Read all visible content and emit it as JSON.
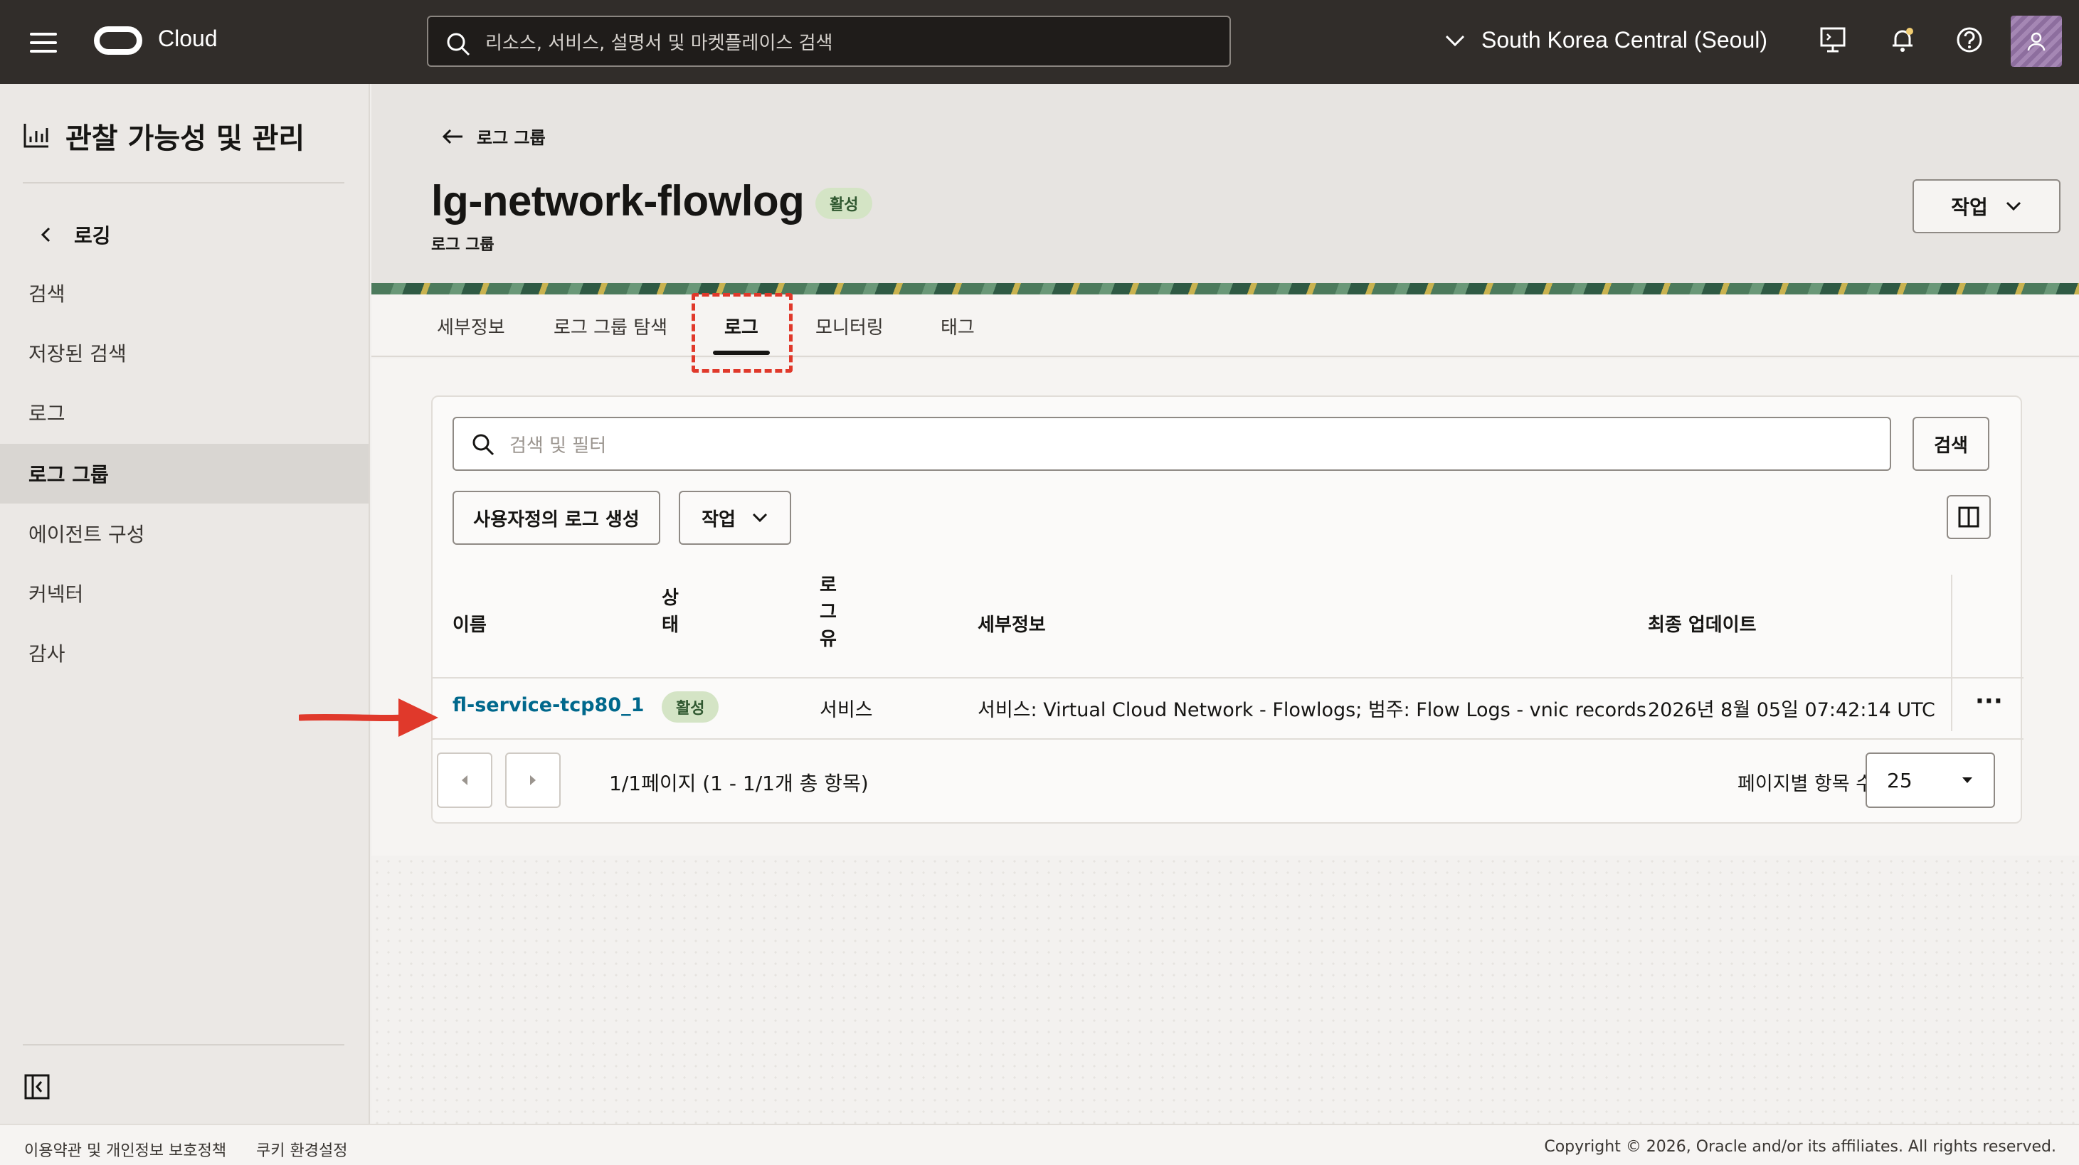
{
  "header": {
    "app_name": "Cloud",
    "search_placeholder": "리소스, 서비스, 설명서 및 마켓플레이스 검색",
    "region": "South Korea Central (Seoul)"
  },
  "sidebar": {
    "title": "관찰 가능성 및 관리",
    "back_label": "로깅",
    "items": [
      {
        "label": "검색"
      },
      {
        "label": "저장된 검색"
      },
      {
        "label": "로그"
      },
      {
        "label": "로그 그룹"
      },
      {
        "label": "에이전트 구성"
      },
      {
        "label": "커넥터"
      },
      {
        "label": "감사"
      }
    ]
  },
  "page": {
    "back_label": "로그 그룹",
    "title": "lg-network-flowlog",
    "status_badge": "활성",
    "subtitle": "로그 그룹",
    "actions_label": "작업"
  },
  "tabs": [
    {
      "label": "세부정보"
    },
    {
      "label": "로그 그룹 탐색"
    },
    {
      "label": "로그"
    },
    {
      "label": "모니터링"
    },
    {
      "label": "태그"
    }
  ],
  "toolbar": {
    "search_placeholder": "검색 및 필터",
    "search_button": "검색",
    "create_button": "사용자정의 로그 생성",
    "actions_button": "작업"
  },
  "table": {
    "columns": {
      "name": "이름",
      "status_1": "상",
      "status_2": "태",
      "type_1": "로",
      "type_2": "그",
      "type_3": "유",
      "details": "세부정보",
      "updated": "최종 업데이트"
    },
    "rows": [
      {
        "name": "fl-service-tcp80_1",
        "status": "활성",
        "type": "서비스",
        "details": "서비스: Virtual Cloud Network - Flowlogs; 범주: Flow Logs - vnic records",
        "updated": "2026년 8월 05일 07:42:14 UTC",
        "more": "···"
      }
    ]
  },
  "pagination": {
    "text": "1/1페이지 (1 - 1/1개 총 항목)",
    "per_page_label": "페이지별 항목 수",
    "per_page_value": "25"
  },
  "footer": {
    "terms": "이용약관 및 개인정보 보호정책",
    "cookies": "쿠키 환경설정",
    "copyright": "Copyright © 2026, Oracle and/or its affiliates. All rights reserved."
  }
}
